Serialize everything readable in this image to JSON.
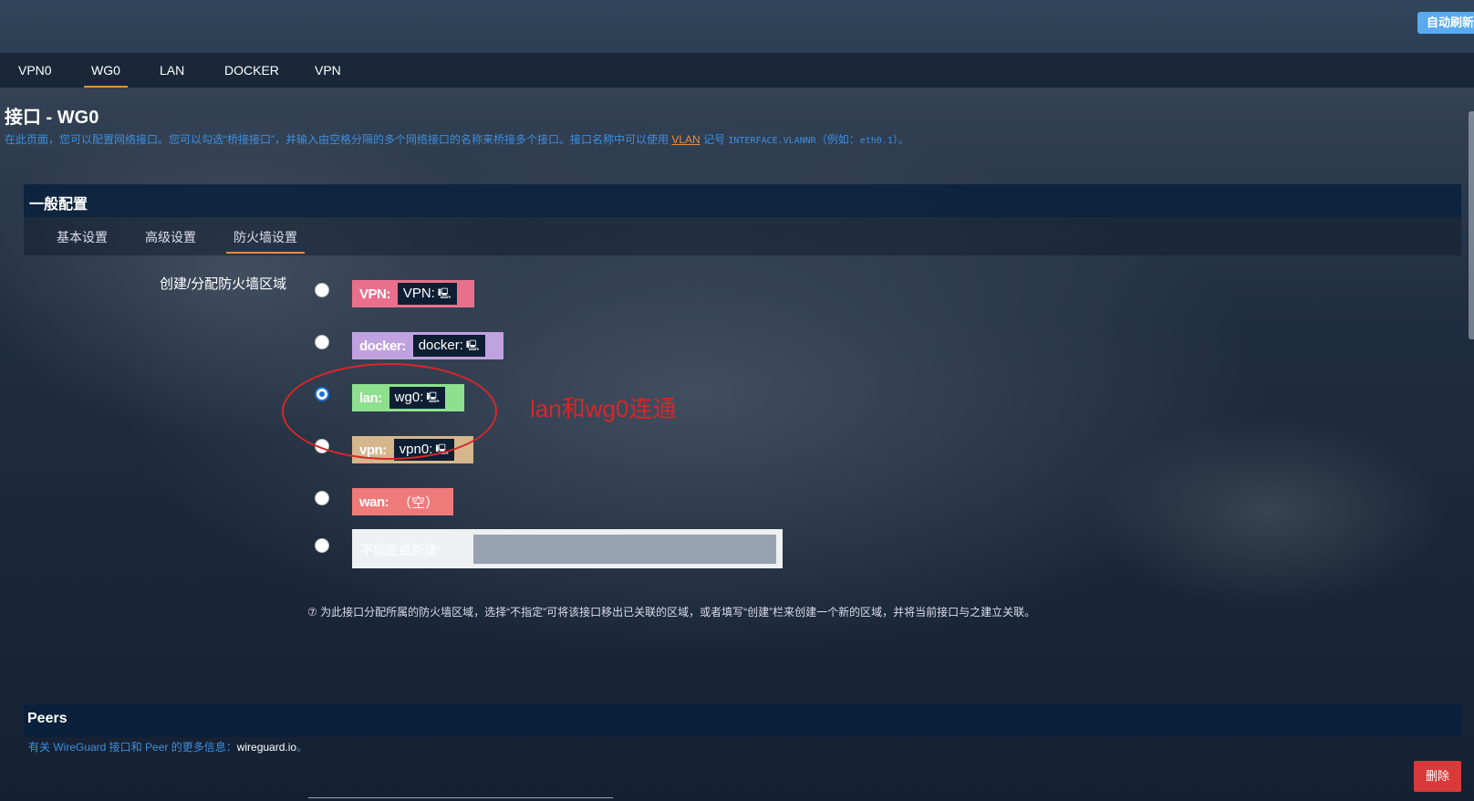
{
  "header": {
    "auto_refresh": "自动刷新"
  },
  "tabs": [
    {
      "label": "VPN0",
      "active": false
    },
    {
      "label": "WG0",
      "active": true
    },
    {
      "label": "LAN",
      "active": false
    },
    {
      "label": "DOCKER",
      "active": false
    },
    {
      "label": "VPN",
      "active": false
    }
  ],
  "page": {
    "title": "接口 - WG0",
    "desc_before": "在此页面，您可以配置网络接口。您可以勾选“桥接接口”，并输入由空格分隔的多个网络接口的名称来桥接多个接口。接口名称中可以使用 ",
    "desc_vlan": "VLAN",
    "desc_mid": " 记号 ",
    "desc_code": "INTERFACE.VLANNR",
    "desc_after": "（例如：",
    "desc_example": "eth0.1",
    "desc_end": "）。"
  },
  "general": {
    "title": "一般配置",
    "subtabs": [
      {
        "label": "基本设置",
        "active": false
      },
      {
        "label": "高级设置",
        "active": false
      },
      {
        "label": "防火墙设置",
        "active": true
      }
    ],
    "firewall_label": "创建/分配防火墙区域",
    "zones": [
      {
        "name": "VPN:",
        "iface": "VPN:",
        "color": "#e9708c",
        "checked": false
      },
      {
        "name": "docker:",
        "iface": "docker:",
        "color": "#c1a2e0",
        "checked": false
      },
      {
        "name": "lan:",
        "iface": "wg0:",
        "color": "#8ee08e",
        "checked": true
      },
      {
        "name": "vpn:",
        "iface": "vpn0:",
        "color": "#d6b68c",
        "checked": false
      },
      {
        "name": "wan:",
        "empty": "（空）",
        "color": "#ef7a7a",
        "checked": false
      }
    ],
    "new_zone_label": "不指定或新建:",
    "help": "⑦ 为此接口分配所属的防火墙区域，选择“不指定”可将该接口移出已关联的区域，或者填写“创建”栏来创建一个新的区域，并将当前接口与之建立关联。"
  },
  "annotation": {
    "text": "lan和wg0连通",
    "color": "#d82626"
  },
  "peers": {
    "title": "Peers",
    "info": "有关 WireGuard 接口和 Peer 的更多信息：",
    "link": "wireguard.io",
    "info_end": "。",
    "delete": "删除"
  }
}
